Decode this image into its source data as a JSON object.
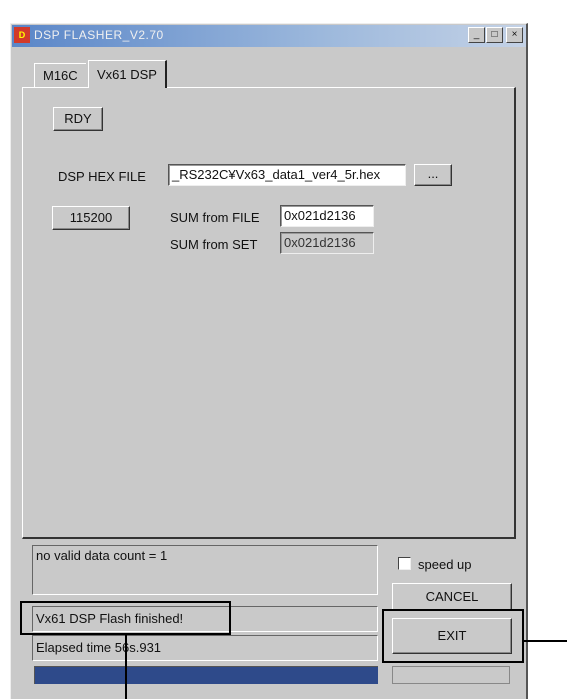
{
  "window": {
    "title": "DSP FLASHER_V2.70",
    "icon": "app-icon"
  },
  "titlebar_buttons": {
    "minimize": "_",
    "maximize": "□",
    "close": "×"
  },
  "tabs": [
    {
      "label": "M16C",
      "active": false
    },
    {
      "label": "Vx61 DSP",
      "active": true
    }
  ],
  "panel": {
    "rdy_label": "RDY",
    "hex_file_label": "DSP HEX FILE",
    "hex_file_value": "_RS232C¥Vx63_data1_ver4_5r.hex",
    "browse_label": "...",
    "baud_label": "115200",
    "sum_file_label": "SUM from FILE",
    "sum_file_value": "0x021d2136",
    "sum_set_label": "SUM from SET",
    "sum_set_value": "0x021d2136"
  },
  "status": {
    "log_text": "no valid data count = 1",
    "message": "Vx61 DSP Flash finished!",
    "elapsed": "Elapsed time 56s.931",
    "progress_fraction": 1.0
  },
  "controls": {
    "speed_up_label": "speed up",
    "speed_up_checked": false,
    "cancel_label": "CANCEL",
    "exit_label": "EXIT"
  },
  "colors": {
    "titlebar": "#5a86c8",
    "window_bg": "#c9c9c9",
    "progress": "#2e4a8a"
  }
}
